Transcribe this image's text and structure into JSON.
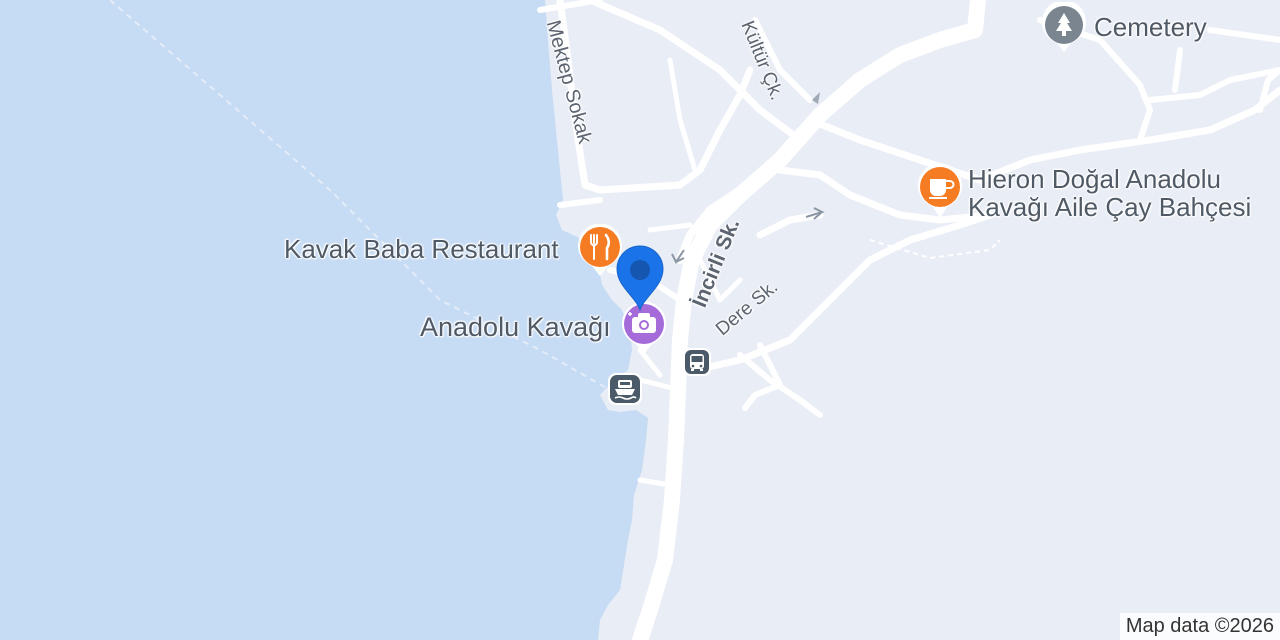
{
  "map": {
    "colors": {
      "water": "#c6dbf4",
      "land": "#e9edf5",
      "road": "#ffffff",
      "restaurant": "#f57c22",
      "cafe": "#f57c22",
      "attraction": "#a56bd8",
      "cemetery": "#7a8590",
      "transit": "#4b5a68",
      "location_pin": "#1a73e8"
    },
    "places": [
      {
        "name": "Kavak Baba Restaurant",
        "category": "restaurant",
        "icon": "fork-knife-icon"
      },
      {
        "name": "Anadolu Kavağı",
        "category": "attraction",
        "icon": "camera-icon"
      },
      {
        "name": "Cemetery",
        "category": "cemetery",
        "icon": "tree-icon"
      },
      {
        "name": "Hieron Doğal Anadolu Kavağı Aile Çay Bahçesi",
        "category": "cafe",
        "icon": "coffee-cup-icon",
        "lines": [
          "Hieron Doğal Anadolu",
          "Kavağı Aile Çay Bahçesi"
        ]
      }
    ],
    "streets": [
      "Mektep Sokak",
      "Kültür Çk.",
      "İncirli Sk.",
      "Dere Sk."
    ],
    "transit": [
      {
        "type": "bus",
        "icon": "bus-icon"
      },
      {
        "type": "ferry",
        "icon": "ferry-icon"
      }
    ],
    "attribution": "Map data ©2026"
  }
}
